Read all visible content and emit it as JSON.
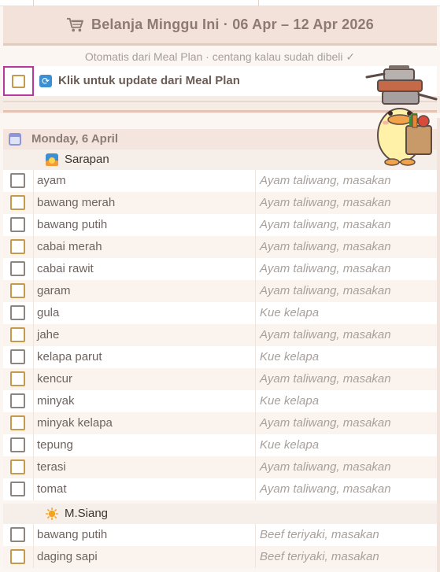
{
  "header": {
    "title": "Belanja Minggu Ini  ·  06 Apr – 12 Apr 2026",
    "subtitle": "Otomatis dari Meal Plan · centang kalau sudah dibeli ✓",
    "cart_icon": "cart-icon"
  },
  "update": {
    "label": "Klik untuk update dari Meal Plan",
    "icon": "refresh-icon"
  },
  "day": {
    "label": "Monday,  6 April",
    "icon": "calendar-icon"
  },
  "meals": [
    {
      "label": "Sarapan",
      "icon": "sunrise-icon",
      "items": [
        {
          "name": "ayam",
          "recipe": "Ayam taliwang, masakan"
        },
        {
          "name": "bawang merah",
          "recipe": "Ayam taliwang, masakan"
        },
        {
          "name": "bawang putih",
          "recipe": "Ayam taliwang, masakan"
        },
        {
          "name": "cabai merah",
          "recipe": "Ayam taliwang, masakan"
        },
        {
          "name": "cabai rawit",
          "recipe": "Ayam taliwang, masakan"
        },
        {
          "name": "garam",
          "recipe": "Ayam taliwang, masakan"
        },
        {
          "name": "gula",
          "recipe": "Kue kelapa"
        },
        {
          "name": "jahe",
          "recipe": "Ayam taliwang, masakan"
        },
        {
          "name": "kelapa parut",
          "recipe": "Kue kelapa"
        },
        {
          "name": "kencur",
          "recipe": "Ayam taliwang, masakan"
        },
        {
          "name": "minyak",
          "recipe": "Kue kelapa"
        },
        {
          "name": "minyak kelapa",
          "recipe": "Ayam taliwang, masakan"
        },
        {
          "name": "tepung",
          "recipe": "Kue kelapa"
        },
        {
          "name": "terasi",
          "recipe": "Ayam taliwang, masakan"
        },
        {
          "name": "tomat",
          "recipe": "Ayam taliwang, masakan"
        }
      ]
    },
    {
      "label": "M.Siang",
      "icon": "sun-icon",
      "items": [
        {
          "name": "bawang putih",
          "recipe": "Beef teriyaki, masakan"
        },
        {
          "name": "daging sapi",
          "recipe": "Beef teriyaki, masakan"
        }
      ]
    }
  ],
  "colors": {
    "header_bg": "#f3e2d9",
    "accent_border": "#b6379d",
    "checkbox_gold": "#c49a4c",
    "checkbox_gray": "#8c8683"
  }
}
